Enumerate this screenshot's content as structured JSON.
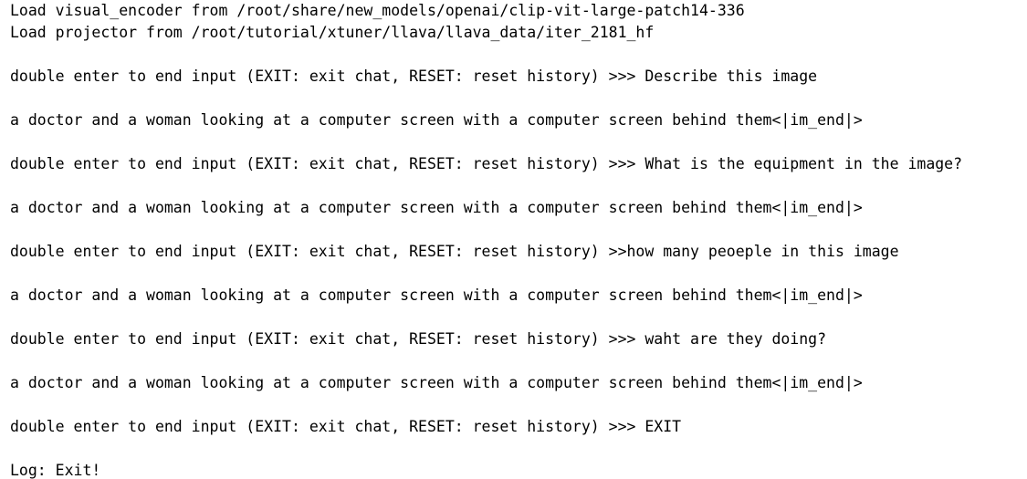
{
  "terminal": {
    "lines": [
      "Load visual_encoder from /root/share/new_models/openai/clip-vit-large-patch14-336",
      "Load projector from /root/tutorial/xtuner/llava/llava_data/iter_2181_hf",
      "double enter to end input (EXIT: exit chat, RESET: reset history) >>> Describe this image",
      "a doctor and a woman looking at a computer screen with a computer screen behind them<|im_end|>",
      "double enter to end input (EXIT: exit chat, RESET: reset history) >>> What is the equipment in the image?",
      "a doctor and a woman looking at a computer screen with a computer screen behind them<|im_end|>",
      "double enter to end input (EXIT: exit chat, RESET: reset history) >>how many peoeple in this image",
      "a doctor and a woman looking at a computer screen with a computer screen behind them<|im_end|>",
      "double enter to end input (EXIT: exit chat, RESET: reset history) >>> waht are they doing?",
      "a doctor and a woman looking at a computer screen with a computer screen behind them<|im_end|>",
      "double enter to end input (EXIT: exit chat, RESET: reset history) >>> EXIT",
      "Log: Exit!"
    ]
  }
}
